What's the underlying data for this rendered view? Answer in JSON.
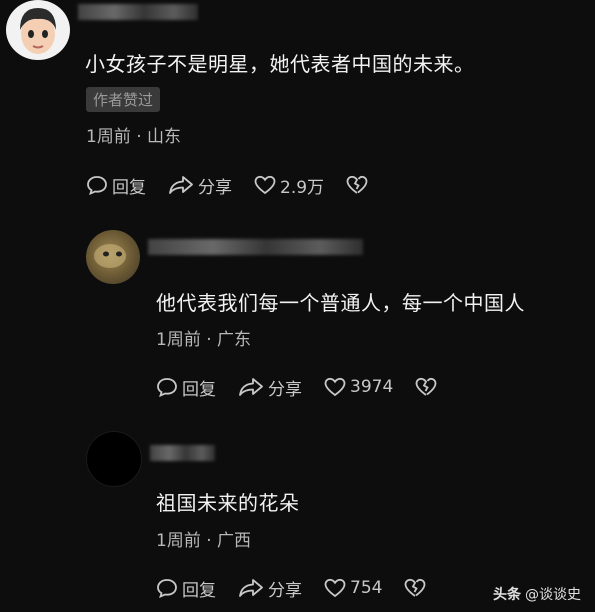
{
  "comments": [
    {
      "text": "小女孩子不是明星，她代表者中国的未来。",
      "badge": "作者赞过",
      "meta": "1周前 · 山东",
      "reply": "回复",
      "share": "分享",
      "likes": "2.9万"
    },
    {
      "text": "他代表我们每一个普通人，每一个中国人",
      "meta": "1周前 · 广东",
      "reply": "回复",
      "share": "分享",
      "likes": "3974"
    },
    {
      "text": "祖国未来的花朵",
      "meta": "1周前 · 广西",
      "reply": "回复",
      "share": "分享",
      "likes": "754"
    }
  ],
  "watermark": {
    "brand": "头条",
    "handle": "@谈谈史"
  },
  "colors": {
    "background": "#0d0d0d",
    "text": "#f2f2f2",
    "meta": "#b8b8b8"
  }
}
